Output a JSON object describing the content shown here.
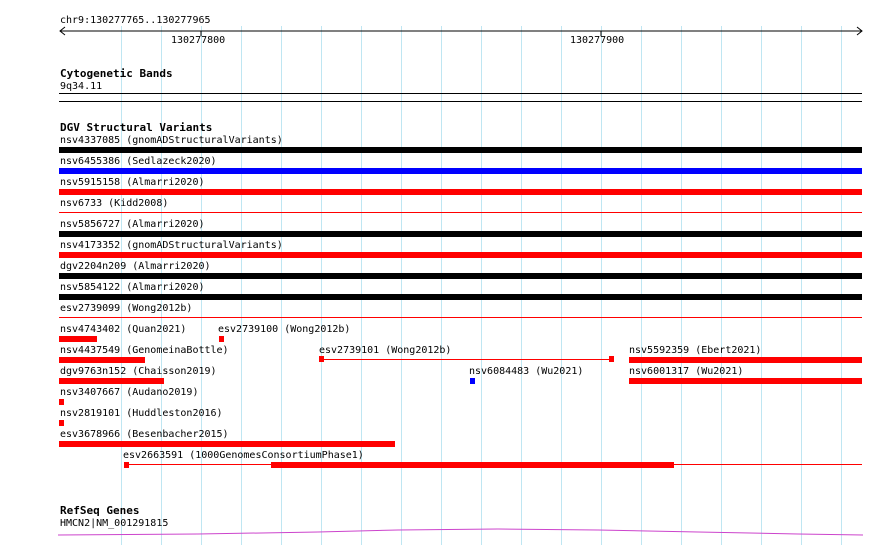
{
  "ruler": {
    "coords": "chr9:130277765..130277965",
    "ticks": [
      "130277800",
      "130277900"
    ]
  },
  "cytoband": {
    "title": "Cytogenetic Bands",
    "band": "9q34.11"
  },
  "dgv": {
    "title": "DGV Structural Variants",
    "variants": [
      {
        "id": "v1",
        "label": "nsv4337085 (gnomADStructuralVariants)",
        "color": "#000000",
        "thick": true
      },
      {
        "id": "v2",
        "label": "nsv6455386 (Sedlazeck2020)",
        "color": "#0000ff",
        "thick": true
      },
      {
        "id": "v3",
        "label": "nsv5915158 (Almarri2020)",
        "color": "#ff0000",
        "thick": true
      },
      {
        "id": "v4",
        "label": "nsv6733 (Kidd2008)",
        "color": "#ff0000",
        "thick": false
      },
      {
        "id": "v5",
        "label": "nsv5856727 (Almarri2020)",
        "color": "#000000",
        "thick": true
      },
      {
        "id": "v6",
        "label": "nsv4173352 (gnomADStructuralVariants)",
        "color": "#ff0000",
        "thick": true
      },
      {
        "id": "v7",
        "label": "dgv2204n209 (Almarri2020)",
        "color": "#000000",
        "thick": true
      },
      {
        "id": "v8",
        "label": "nsv5854122 (Almarri2020)",
        "color": "#000000",
        "thick": true
      },
      {
        "id": "v9",
        "label": "esv2739099 (Wong2012b)",
        "color": "#ff0000",
        "thick": false
      },
      {
        "id": "v10",
        "label": "nsv4743402 (Quan2021)",
        "color": "#ff0000",
        "thick": true
      },
      {
        "id": "v11",
        "label": "esv2739100 (Wong2012b)",
        "color": "#ff0000",
        "thick": true
      },
      {
        "id": "v12",
        "label": "nsv4437549 (GenomeinaBottle)",
        "color": "#ff0000",
        "thick": true
      },
      {
        "id": "v13",
        "label": "esv2739101 (Wong2012b)",
        "color": "#ff0000",
        "thick": false
      },
      {
        "id": "v14",
        "label": "nsv5592359 (Ebert2021)",
        "color": "#ff0000",
        "thick": true
      },
      {
        "id": "v15",
        "label": "dgv9763n152 (Chaisson2019)",
        "color": "#ff0000",
        "thick": true
      },
      {
        "id": "v16",
        "label": "nsv6084483 (Wu2021)",
        "color": "#0000ff",
        "thick": true
      },
      {
        "id": "v17",
        "label": "nsv6001317 (Wu2021)",
        "color": "#ff0000",
        "thick": true
      },
      {
        "id": "v18",
        "label": "nsv3407667 (Audano2019)",
        "color": "#ff0000",
        "thick": true
      },
      {
        "id": "v19",
        "label": "nsv2819101 (Huddleston2016)",
        "color": "#ff0000",
        "thick": true
      },
      {
        "id": "v20",
        "label": "esv3678966 (Besenbacher2015)",
        "color": "#ff0000",
        "thick": true
      },
      {
        "id": "v21",
        "label": "esv2663591 (1000GenomesConsortiumPhase1)",
        "color": "#ff0000",
        "thick": true
      }
    ]
  },
  "refseq": {
    "title": "RefSeq Genes",
    "gene": "HMCN2|NM_001291815",
    "color": "#cc44cc"
  }
}
